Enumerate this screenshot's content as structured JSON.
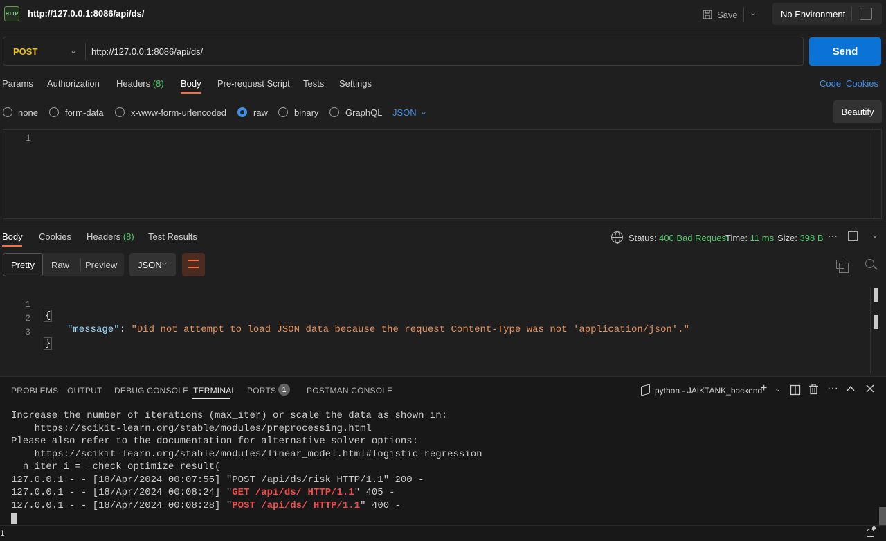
{
  "app": {
    "tab_icon_text": "HTTP",
    "tab_title": "http://127.0.0.1:8086/api/ds/",
    "save_label": "Save",
    "environment": "No Environment"
  },
  "request": {
    "method": "POST",
    "url": "http://127.0.0.1:8086/api/ds/",
    "send_label": "Send",
    "tabs": [
      {
        "label": "Params"
      },
      {
        "label": "Authorization"
      },
      {
        "label": "Headers",
        "count": "(8)"
      },
      {
        "label": "Body"
      },
      {
        "label": "Pre-request Script"
      },
      {
        "label": "Tests"
      },
      {
        "label": "Settings"
      }
    ],
    "active_tab": "Body",
    "code_link": "Code",
    "cookies_link": "Cookies",
    "body_types": [
      "none",
      "form-data",
      "x-www-form-urlencoded",
      "raw",
      "binary",
      "GraphQL"
    ],
    "selected_body_type": "raw",
    "raw_language": "JSON",
    "beautify_label": "Beautify",
    "editor_line_numbers": [
      "1"
    ]
  },
  "response": {
    "tabs": [
      {
        "label": "Body"
      },
      {
        "label": "Cookies"
      },
      {
        "label": "Headers",
        "count": "(8)"
      },
      {
        "label": "Test Results"
      }
    ],
    "active_tab": "Body",
    "status_label": "Status:",
    "status_value": "400 Bad Request",
    "time_label": "Time:",
    "time_value": "11 ms",
    "size_label": "Size:",
    "size_value": "398 B",
    "more_label": "···",
    "view_modes": [
      "Pretty",
      "Raw",
      "Preview"
    ],
    "active_view": "Pretty",
    "format": "JSON",
    "code": {
      "line_numbers": [
        "1",
        "2",
        "3"
      ],
      "open_brace": "{",
      "close_brace": "}",
      "key": "\"message\"",
      "colon": ": ",
      "value": "\"Did not attempt to load JSON data because the request Content-Type was not 'application/json'.\""
    }
  },
  "panel": {
    "tabs": [
      "PROBLEMS",
      "OUTPUT",
      "DEBUG CONSOLE",
      "TERMINAL",
      "PORTS",
      "POSTMAN CONSOLE"
    ],
    "active_tab": "TERMINAL",
    "ports_badge": "1",
    "terminal_name": "python - JAIKTANK_backend",
    "icons": {
      "add": "+",
      "dropdown": "⌵",
      "split": "split-icon",
      "trash": "trash-icon",
      "more": "···",
      "maximize": "^",
      "close": "✕"
    },
    "terminal_lines": [
      "Increase the number of iterations (max_iter) or scale the data as shown in:",
      "    https://scikit-learn.org/stable/modules/preprocessing.html",
      "Please also refer to the documentation for alternative solver options:",
      "    https://scikit-learn.org/stable/modules/linear_model.html#logistic-regression",
      "  n_iter_i = _check_optimize_result(",
      "127.0.0.1 - - [18/Apr/2024 00:07:55] \"POST /api/ds/risk HTTP/1.1\" 200 -"
    ],
    "log_lines": [
      {
        "prefix": "127.0.0.1 - - [18/Apr/2024 00:08:24] \"",
        "highlight": "GET /api/ds/ HTTP/1.1",
        "suffix": "\" 405 -"
      },
      {
        "prefix": "127.0.0.1 - - [18/Apr/2024 00:08:28] \"",
        "highlight": "POST /api/ds/ HTTP/1.1",
        "suffix": "\" 400 -"
      }
    ]
  },
  "statusbar": {
    "left_text": "1"
  },
  "colors": {
    "accent": "#ff6c37",
    "send": "#0b73d6",
    "success": "#4ec96b",
    "method": "#f0c000",
    "error": "#f14c4c"
  }
}
